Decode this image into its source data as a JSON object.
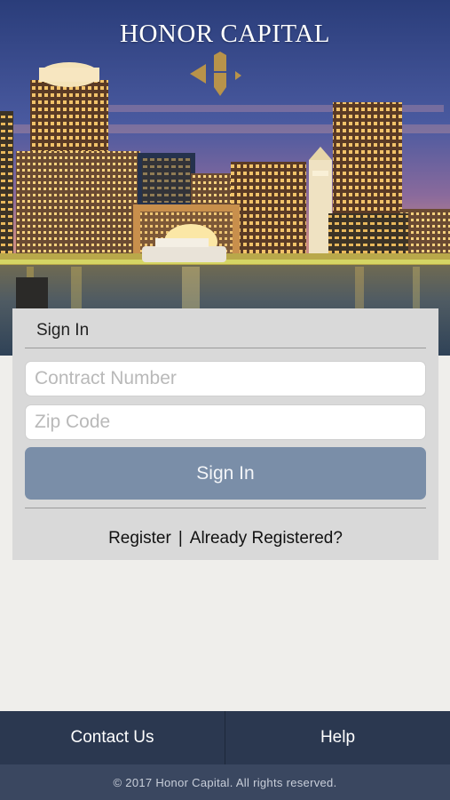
{
  "brand": {
    "name": "HONOR CAPITAL"
  },
  "signin": {
    "title": "Sign In",
    "contract_placeholder": "Contract Number",
    "contract_value": "",
    "zip_placeholder": "Zip Code",
    "zip_value": "",
    "button_label": "Sign In",
    "register_label": "Register",
    "separator": "|",
    "already_registered_label": "Already Registered?"
  },
  "footer": {
    "contact_label": "Contact Us",
    "help_label": "Help",
    "copyright": "© 2017 Honor Capital. All rights reserved."
  },
  "colors": {
    "button": "#7a8ea8",
    "tabbar": "#2b3850",
    "copyright_bar": "#3a4760",
    "logo_gold": "#b8934a"
  }
}
